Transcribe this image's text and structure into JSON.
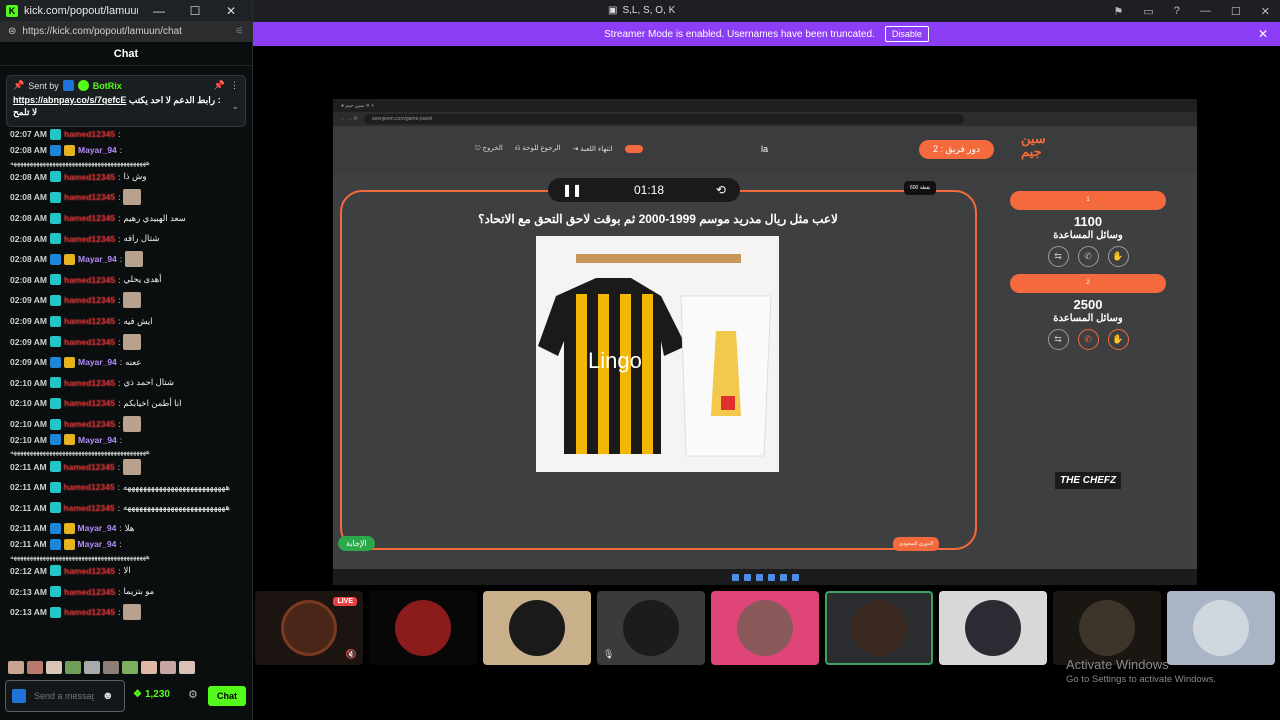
{
  "chat_window": {
    "title": "kick.com/popout/lamuun/chat - ...",
    "url": "https://kick.com/popout/lamuun/chat",
    "header": "Chat",
    "pinned": {
      "sent_by_prefix": "Sent by",
      "sender": "BotRix",
      "text_line1": "رابط الدعم لا احد يكتب : https://abnpay.co/s/7qefcE",
      "link": "https://abnpay.co/s/7qefcE",
      "link_prefix": "رابط الدعم لا احد يكتب :",
      "text_line2": "لا تلمح"
    },
    "messages": [
      {
        "time": "02:07 AM",
        "user": "hamed12345",
        "text": "",
        "color": "red",
        "badges": [
          "teal"
        ]
      },
      {
        "time": "02:08 AM",
        "user": "Mayar_94",
        "text": "",
        "color": "purple",
        "badges": [
          "blue",
          "gold"
        ],
        "line2": "ههههههههههههههههههههههههههههههههههههههههههه"
      },
      {
        "time": "02:08 AM",
        "user": "hamed12345",
        "text": "وش ذا",
        "color": "red",
        "badges": [
          "teal"
        ]
      },
      {
        "time": "02:08 AM",
        "user": "hamed12345",
        "text": "",
        "color": "red",
        "badges": [
          "teal"
        ],
        "emote": true
      },
      {
        "time": "02:08 AM",
        "user": "hamed12345",
        "text": "سعد الهبيدي رهيم",
        "color": "red",
        "badges": [
          "teal"
        ]
      },
      {
        "time": "02:08 AM",
        "user": "hamed12345",
        "text": "شتال رافه",
        "color": "red",
        "badges": [
          "teal"
        ]
      },
      {
        "time": "02:08 AM",
        "user": "Mayar_94",
        "text": "",
        "color": "purple",
        "badges": [
          "blue",
          "gold"
        ],
        "emote": true
      },
      {
        "time": "02:08 AM",
        "user": "hamed12345",
        "text": "أهدى يحلي",
        "color": "red",
        "badges": [
          "teal"
        ]
      },
      {
        "time": "02:09 AM",
        "user": "hamed12345",
        "text": "",
        "color": "red",
        "badges": [
          "teal"
        ],
        "emote": true
      },
      {
        "time": "02:09 AM",
        "user": "hamed12345",
        "text": "ايش فيه",
        "color": "red",
        "badges": [
          "teal"
        ]
      },
      {
        "time": "02:09 AM",
        "user": "hamed12345",
        "text": "",
        "color": "red",
        "badges": [
          "teal"
        ],
        "emote": true
      },
      {
        "time": "02:09 AM",
        "user": "Mayar_94",
        "text": "ععنه",
        "color": "purple",
        "badges": [
          "blue",
          "gold"
        ]
      },
      {
        "time": "02:10 AM",
        "user": "hamed12345",
        "text": "شتال احمد ذي",
        "color": "red",
        "badges": [
          "teal"
        ]
      },
      {
        "time": "02:10 AM",
        "user": "hamed12345",
        "text": "انا أطمن اخيابكم",
        "color": "red",
        "badges": [
          "teal"
        ]
      },
      {
        "time": "02:10 AM",
        "user": "hamed12345",
        "text": "",
        "color": "red",
        "badges": [
          "teal"
        ],
        "emote": true
      },
      {
        "time": "02:10 AM",
        "user": "Mayar_94",
        "text": "",
        "color": "purple",
        "badges": [
          "blue",
          "gold"
        ],
        "line2": "ههههههههههههههههههههههههههههههههههههههههههه"
      },
      {
        "time": "02:11 AM",
        "user": "hamed12345",
        "text": "",
        "color": "red",
        "badges": [
          "teal"
        ],
        "emote": true
      },
      {
        "time": "02:11 AM",
        "user": "hamed12345",
        "text": "ههههههههههههههههههههههههههه",
        "color": "red",
        "badges": [
          "teal"
        ]
      },
      {
        "time": "02:11 AM",
        "user": "hamed12345",
        "text": "ههههههههههههههههههههههههههه",
        "color": "red",
        "badges": [
          "teal"
        ]
      },
      {
        "time": "02:11 AM",
        "user": "Mayar_94",
        "text": "هلا",
        "color": "purple",
        "badges": [
          "blue",
          "gold"
        ]
      },
      {
        "time": "02:11 AM",
        "user": "Mayar_94",
        "text": "",
        "color": "purple",
        "badges": [
          "blue",
          "gold"
        ],
        "line2": "ههههههههههههههههههههههههههههههههههههههههههه"
      },
      {
        "time": "02:12 AM",
        "user": "hamed12345",
        "text": "الا",
        "color": "red",
        "badges": [
          "teal"
        ]
      },
      {
        "time": "02:13 AM",
        "user": "hamed12345",
        "text": "مو بتزيما",
        "color": "red",
        "badges": [
          "teal"
        ]
      },
      {
        "time": "02:13 AM",
        "user": "hamed12345",
        "text": "",
        "color": "red",
        "badges": [
          "teal"
        ],
        "emote": true
      }
    ],
    "input_placeholder": "Send a message",
    "points": "1,230",
    "chat_button": "Chat"
  },
  "app": {
    "window_title": "S,L, S, O, K",
    "streamer_banner": "Streamer Mode is enabled. Usernames have been truncated.",
    "disable_label": "Disable"
  },
  "game": {
    "inner_url": "seenjeem.com/game-panel",
    "logo_text": "سين جيم",
    "turn_label": "دور فريق : 2",
    "typed_text": "la",
    "actions": {
      "end_game": "انتهاء اللعبة",
      "back_to_board": "الرجوع للوحة",
      "exit": "الخروج"
    },
    "timer": "01:18",
    "points_badge": "600 نقطة",
    "question": "لاعب مثل ريال مدريد موسم 1999-2000 ثم بوقت لاحق التحق مع الاتحاد؟",
    "shirt_sponsor": "Lingo",
    "answer_button": "الإجابة",
    "league_tag": "الدوري السعودي",
    "teams": [
      {
        "name": "1",
        "score": "1100",
        "help_label": "وسائل المساعدة"
      },
      {
        "name": "2",
        "score": "2500",
        "help_label": "وسائل المساعدة"
      }
    ],
    "sponsor_logo": "THE CHEFZ"
  },
  "participants": {
    "live_label": "LIVE"
  },
  "watermark": {
    "line1": "Activate Windows",
    "line2": "Go to Settings to activate Windows."
  }
}
